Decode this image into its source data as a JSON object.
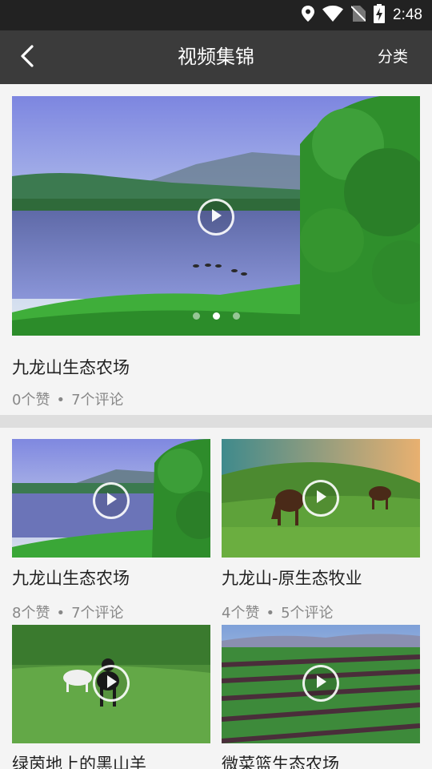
{
  "status_bar": {
    "time": "2:48",
    "icons": [
      "location-icon",
      "wifi-icon",
      "no-sim-icon",
      "battery-charging-icon"
    ]
  },
  "header": {
    "back_icon": "chevron-left-icon",
    "title": "视频集锦",
    "action_label": "分类"
  },
  "featured": {
    "title": "九龙山生态农场",
    "likes": "0个赞",
    "comments": "7个评论",
    "carousel_index": 1,
    "carousel_count": 3
  },
  "videos": [
    {
      "title": "九龙山生态农场",
      "likes": "8个赞",
      "comments": "7个评论"
    },
    {
      "title": "九龙山-原生态牧业",
      "likes": "4个赞",
      "comments": "5个评论"
    },
    {
      "title": "绿茵地上的黑山羊",
      "likes": "",
      "comments": ""
    },
    {
      "title": "微菜篮生态农场",
      "likes": "",
      "comments": ""
    }
  ],
  "meta_separator": "•",
  "colors": {
    "status_bar": "#222222",
    "app_bar": "#3b3b3b",
    "background": "#f4f4f4",
    "meta_text": "#888888"
  }
}
